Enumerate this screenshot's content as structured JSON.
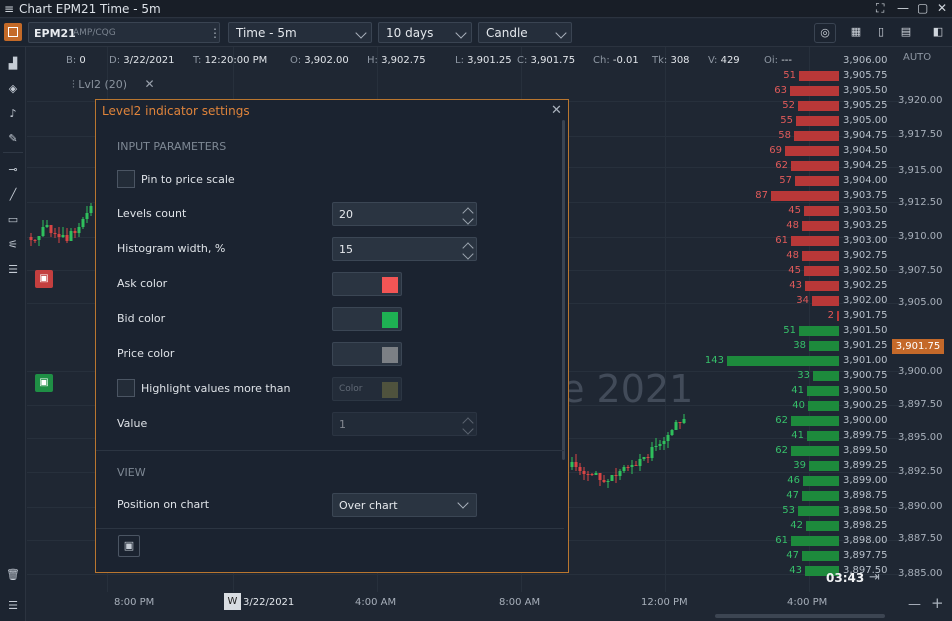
{
  "window": {
    "title": "Chart EPM21 Time - 5m",
    "menu_glyph": "≡",
    "icons": [
      "restore-icon",
      "minimize-icon",
      "maximize-icon",
      "close-icon"
    ]
  },
  "toolbar": {
    "symbol": "EPM21",
    "exchange": "AMP/CQG",
    "timeframe": "Time - 5m",
    "range": "10 days",
    "chart_type": "Candle"
  },
  "infobar": {
    "items": [
      {
        "k": "B:",
        "v": "0"
      },
      {
        "k": "D:",
        "v": "3/22/2021"
      },
      {
        "k": "T:",
        "v": "12:20:00 PM"
      },
      {
        "k": "O:",
        "v": "3,902.00"
      },
      {
        "k": "H:",
        "v": "3,902.75"
      },
      {
        "k": "L:",
        "v": "3,901.25"
      },
      {
        "k": "C:",
        "v": "3,901.75"
      },
      {
        "k": "Ch:",
        "v": "-0.01"
      },
      {
        "k": "Tk:",
        "v": "308"
      },
      {
        "k": "V:",
        "v": "429"
      },
      {
        "k": "Oi:",
        "v": "---"
      }
    ]
  },
  "indicator_tag": {
    "label": "Lvl2 (20)"
  },
  "axis": {
    "auto": "AUTO",
    "prices": [
      "3,920.00",
      "3,917.50",
      "3,915.00",
      "3,912.50",
      "3,910.00",
      "3,907.50",
      "3,905.00",
      "3,900.00",
      "3,897.50",
      "3,895.00",
      "3,892.50",
      "3,890.00",
      "3,887.50",
      "3,885.00"
    ],
    "current": "3,901.75",
    "times": [
      "8:00 PM",
      "3/22/2021",
      "4:00 AM",
      "8:00 AM",
      "12:00 PM",
      "4:00 PM"
    ],
    "week_tag": "W",
    "countdown": "03:43"
  },
  "watermark": "ne 2021",
  "orderbook": {
    "asks": [
      {
        "p": "3,906.00",
        "v": ""
      },
      {
        "p": "3,905.75",
        "v": "51"
      },
      {
        "p": "3,905.50",
        "v": "63"
      },
      {
        "p": "3,905.25",
        "v": "52"
      },
      {
        "p": "3,905.00",
        "v": "55"
      },
      {
        "p": "3,904.75",
        "v": "58"
      },
      {
        "p": "3,904.50",
        "v": "69"
      },
      {
        "p": "3,904.25",
        "v": "62"
      },
      {
        "p": "3,904.00",
        "v": "57"
      },
      {
        "p": "3,903.75",
        "v": "87"
      },
      {
        "p": "3,903.50",
        "v": "45"
      },
      {
        "p": "3,903.25",
        "v": "48"
      },
      {
        "p": "3,903.00",
        "v": "61"
      },
      {
        "p": "3,902.75",
        "v": "48"
      },
      {
        "p": "3,902.50",
        "v": "45"
      },
      {
        "p": "3,902.25",
        "v": "43"
      },
      {
        "p": "3,902.00",
        "v": "34"
      },
      {
        "p": "3,901.75",
        "v": "2"
      }
    ],
    "bids": [
      {
        "p": "3,901.50",
        "v": "51"
      },
      {
        "p": "3,901.25",
        "v": "38"
      },
      {
        "p": "3,901.00",
        "v": "143"
      },
      {
        "p": "3,900.75",
        "v": "33"
      },
      {
        "p": "3,900.50",
        "v": "41"
      },
      {
        "p": "3,900.25",
        "v": "40"
      },
      {
        "p": "3,900.00",
        "v": "62"
      },
      {
        "p": "3,899.75",
        "v": "41"
      },
      {
        "p": "3,899.50",
        "v": "62"
      },
      {
        "p": "3,899.25",
        "v": "39"
      },
      {
        "p": "3,899.00",
        "v": "46"
      },
      {
        "p": "3,898.75",
        "v": "47"
      },
      {
        "p": "3,898.50",
        "v": "53"
      },
      {
        "p": "3,898.25",
        "v": "42"
      },
      {
        "p": "3,898.00",
        "v": "61"
      },
      {
        "p": "3,897.75",
        "v": "47"
      },
      {
        "p": "3,897.50",
        "v": "43"
      }
    ]
  },
  "dialog": {
    "title": "Level2 indicator settings",
    "sections": {
      "input": "INPUT PARAMETERS",
      "view": "VIEW"
    },
    "pin_label": "Pin to price scale",
    "levels_label": "Levels count",
    "levels_value": "20",
    "hist_label": "Histogram width, %",
    "hist_value": "15",
    "ask_label": "Ask color",
    "ask_color": "#f25555",
    "bid_label": "Bid color",
    "bid_color": "#1eb153",
    "price_label": "Price color",
    "price_color": "#7c8085",
    "highlight_label": "Highlight values more than",
    "highlight_color_label": "Color",
    "highlight_color": "#7a7a48",
    "value_label": "Value",
    "value_value": "1",
    "position_label": "Position on chart",
    "position_value": "Over chart"
  }
}
